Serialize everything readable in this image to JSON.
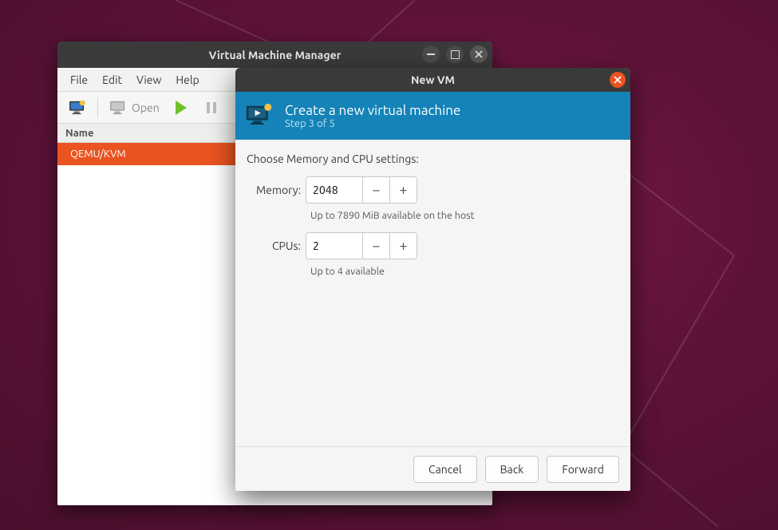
{
  "main_window": {
    "title": "Virtual Machine Manager",
    "menu": {
      "file": "File",
      "edit": "Edit",
      "view": "View",
      "help": "Help"
    },
    "toolbar": {
      "open_label": "Open"
    },
    "list": {
      "header": "Name",
      "rows": [
        "QEMU/KVM"
      ]
    }
  },
  "dialog": {
    "title": "New VM",
    "banner": {
      "heading": "Create a new virtual machine",
      "step": "Step 3 of 5"
    },
    "heading": "Choose Memory and CPU settings:",
    "memory": {
      "label": "Memory:",
      "value": "2048",
      "helper": "Up to 7890 MiB available on the host"
    },
    "cpus": {
      "label": "CPUs:",
      "value": "2",
      "helper": "Up to 4 available"
    },
    "buttons": {
      "cancel": "Cancel",
      "back": "Back",
      "forward": "Forward"
    }
  }
}
